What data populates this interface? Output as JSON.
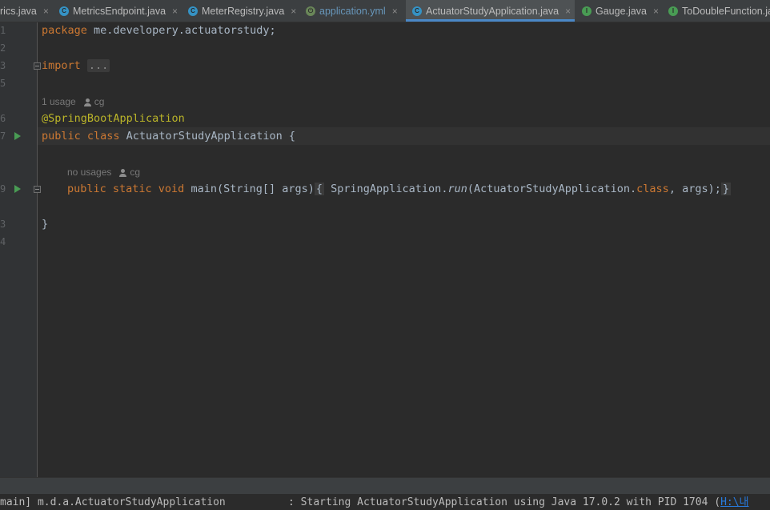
{
  "tabs": [
    {
      "label": "rics.java",
      "icon": "none"
    },
    {
      "label": "MetricsEndpoint.java",
      "icon": "class-icon"
    },
    {
      "label": "MeterRegistry.java",
      "icon": "class-icon"
    },
    {
      "label": "application.yml",
      "icon": "spring-yml-icon"
    },
    {
      "label": "ActuatorStudyApplication.java",
      "icon": "class-icon"
    },
    {
      "label": "Gauge.java",
      "icon": "interface-icon"
    },
    {
      "label": "ToDoubleFunction.ja",
      "icon": "interface-icon"
    }
  ],
  "close_glyph": "×",
  "line_numbers": [
    "1",
    "2",
    "3",
    "5",
    "",
    "6",
    "7",
    "",
    "",
    "9",
    "",
    "3",
    "4"
  ],
  "code": {
    "l1_kw": "package",
    "l1_rest": " me.developery.actuatorstudy;",
    "l3_kw": "import",
    "l3_fold": "...",
    "hint1_usage": "1 usage",
    "hint1_author": "cg",
    "l6_ann": "@SpringBootApplication",
    "l7_kw": "public class",
    "l7_rest": " ActuatorStudyApplication {",
    "hint2_usage": "no usages",
    "hint2_author": "cg",
    "l9_kw": "public static void",
    "l9_name": " main(String[] args)",
    "l9_open": "{",
    "l9_call": " SpringApplication.",
    "l9_run": "run",
    "l9_args1": "(ActuatorStudyApplication.",
    "l9_class": "class",
    "l9_args2": ", args);",
    "l9_close": "}",
    "l_end": "}"
  },
  "console": {
    "text": "main] m.d.a.ActuatorStudyApplication          : Starting ActuatorStudyApplication using Java 17.0.2 with PID 1704 (",
    "link": "H:\\내"
  },
  "colors": {
    "keyword": "#cc7832",
    "annotation": "#bbb529",
    "text": "#a9b7c6",
    "background": "#2b2b2b"
  }
}
